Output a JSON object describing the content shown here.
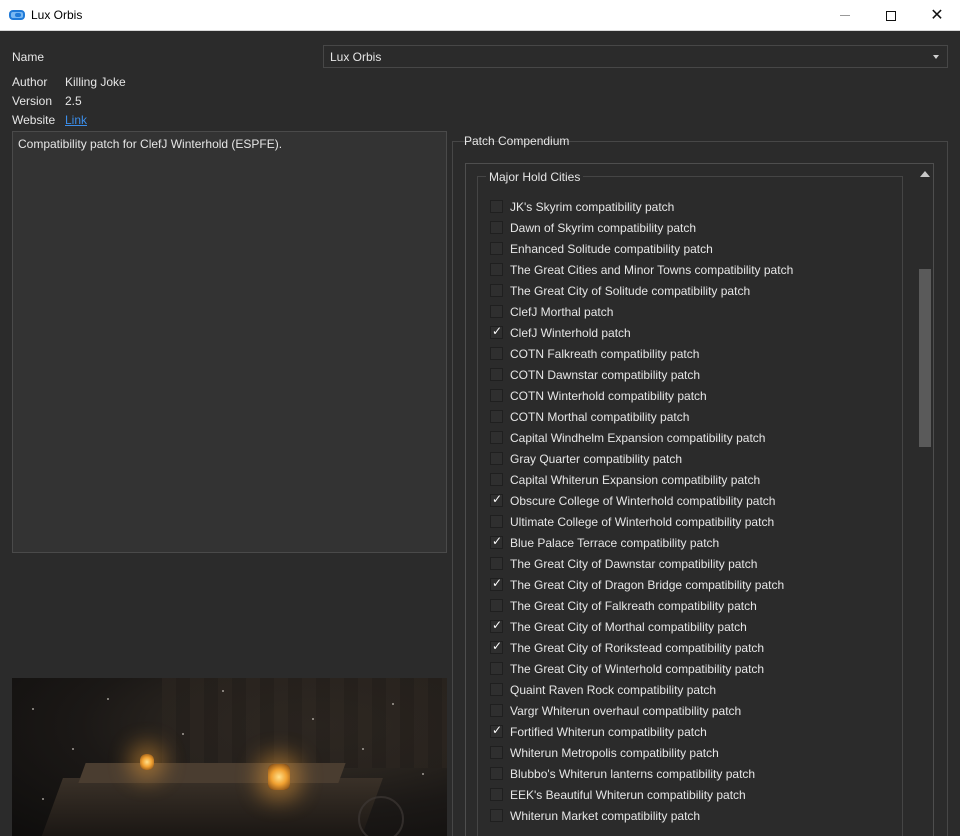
{
  "window": {
    "title": "Lux Orbis"
  },
  "info": {
    "name_label": "Name",
    "name_value": "Lux Orbis",
    "author_label": "Author",
    "author_value": "Killing Joke",
    "version_label": "Version",
    "version_value": "2.5",
    "website_label": "Website",
    "website_link": "Link",
    "description": "Compatibility patch for ClefJ Winterhold (ESPFE)."
  },
  "compendium": {
    "label": "Patch Compendium",
    "group": "Major Hold Cities",
    "patches": [
      {
        "label": "JK's Skyrim compatibility patch",
        "checked": false
      },
      {
        "label": "Dawn of Skyrim compatibility patch",
        "checked": false
      },
      {
        "label": "Enhanced Solitude compatibility patch",
        "checked": false
      },
      {
        "label": "The Great Cities and Minor Towns compatibility patch",
        "checked": false
      },
      {
        "label": "The Great City of Solitude compatibility patch",
        "checked": false
      },
      {
        "label": "ClefJ Morthal patch",
        "checked": false
      },
      {
        "label": "ClefJ Winterhold patch",
        "checked": true
      },
      {
        "label": "COTN Falkreath compatibility patch",
        "checked": false
      },
      {
        "label": "COTN Dawnstar compatibility patch",
        "checked": false
      },
      {
        "label": "COTN Winterhold compatibility patch",
        "checked": false
      },
      {
        "label": "COTN Morthal compatibility patch",
        "checked": false
      },
      {
        "label": "Capital Windhelm Expansion compatibility patch",
        "checked": false
      },
      {
        "label": "Gray Quarter compatibility patch",
        "checked": false
      },
      {
        "label": "Capital Whiterun Expansion compatibility patch",
        "checked": false
      },
      {
        "label": "Obscure College of Winterhold compatibility patch",
        "checked": true
      },
      {
        "label": "Ultimate College of Winterhold compatibility patch",
        "checked": false
      },
      {
        "label": "Blue Palace Terrace compatibility patch",
        "checked": true
      },
      {
        "label": "The Great City of Dawnstar compatibility patch",
        "checked": false
      },
      {
        "label": "The Great City of Dragon Bridge compatibility patch",
        "checked": true
      },
      {
        "label": "The Great City of Falkreath compatibility patch",
        "checked": false
      },
      {
        "label": "The Great City of Morthal compatibility patch",
        "checked": true
      },
      {
        "label": "The Great City of Rorikstead compatibility patch",
        "checked": true
      },
      {
        "label": "The Great City of Winterhold compatibility patch",
        "checked": false
      },
      {
        "label": "Quaint Raven Rock compatibility patch",
        "checked": false
      },
      {
        "label": "Vargr Whiterun overhaul compatibility patch",
        "checked": false
      },
      {
        "label": "Fortified Whiterun compatibility patch",
        "checked": true
      },
      {
        "label": "Whiterun Metropolis compatibility patch",
        "checked": false
      },
      {
        "label": "Blubbo's Whiterun lanterns compatibility patch",
        "checked": false
      },
      {
        "label": "EEK's Beautiful Whiterun compatibility patch",
        "checked": false
      },
      {
        "label": "Whiterun Market compatibility patch",
        "checked": false
      }
    ]
  }
}
